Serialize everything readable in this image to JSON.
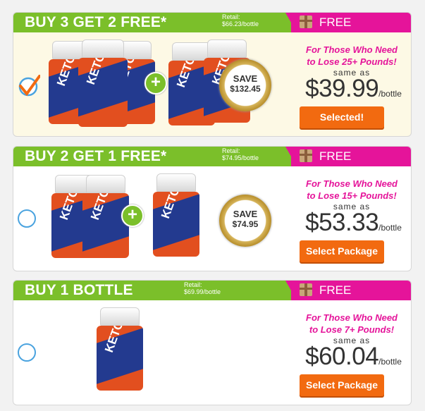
{
  "packages": [
    {
      "title": "BUY 3 GET 2 FREE*",
      "retail_label": "Retail:",
      "retail_value": "$66.23/bottle",
      "free_label": "FREE",
      "tagline_1": "For Those Who Need",
      "tagline_2": "to Lose 25+ Pounds!",
      "same_as": "same as",
      "price": "$39.99",
      "unit": "/bottle",
      "button": "Selected!",
      "save_label": "SAVE",
      "save_amount": "$132.45",
      "selected": true
    },
    {
      "title": "BUY 2 GET 1 FREE*",
      "retail_label": "Retail:",
      "retail_value": "$74.95/bottle",
      "free_label": "FREE",
      "tagline_1": "For Those Who Need",
      "tagline_2": "to Lose 15+ Pounds!",
      "same_as": "same as",
      "price": "$53.33",
      "unit": "/bottle",
      "button": "Select Package",
      "save_label": "SAVE",
      "save_amount": "$74.95",
      "selected": false
    },
    {
      "title": "BUY 1 BOTTLE",
      "retail_label": "Retail:",
      "retail_value": "$69.99/bottle",
      "free_label": "FREE",
      "tagline_1": "For Those Who Need",
      "tagline_2": "to Lose 7+ Pounds!",
      "same_as": "same as",
      "price": "$60.04",
      "unit": "/bottle",
      "button": "Select Package",
      "selected": false
    }
  ],
  "product": {
    "bottle_label": "KETO",
    "icons": [
      "gift-box-icon",
      "checkmark-icon",
      "radio-icon",
      "plus-icon"
    ]
  },
  "colors": {
    "header_green": "#7bbf2a",
    "header_pink": "#e5149a",
    "button_orange": "#f26a10",
    "tagline_pink": "#e5149a",
    "radio_blue": "#4aa3df"
  }
}
